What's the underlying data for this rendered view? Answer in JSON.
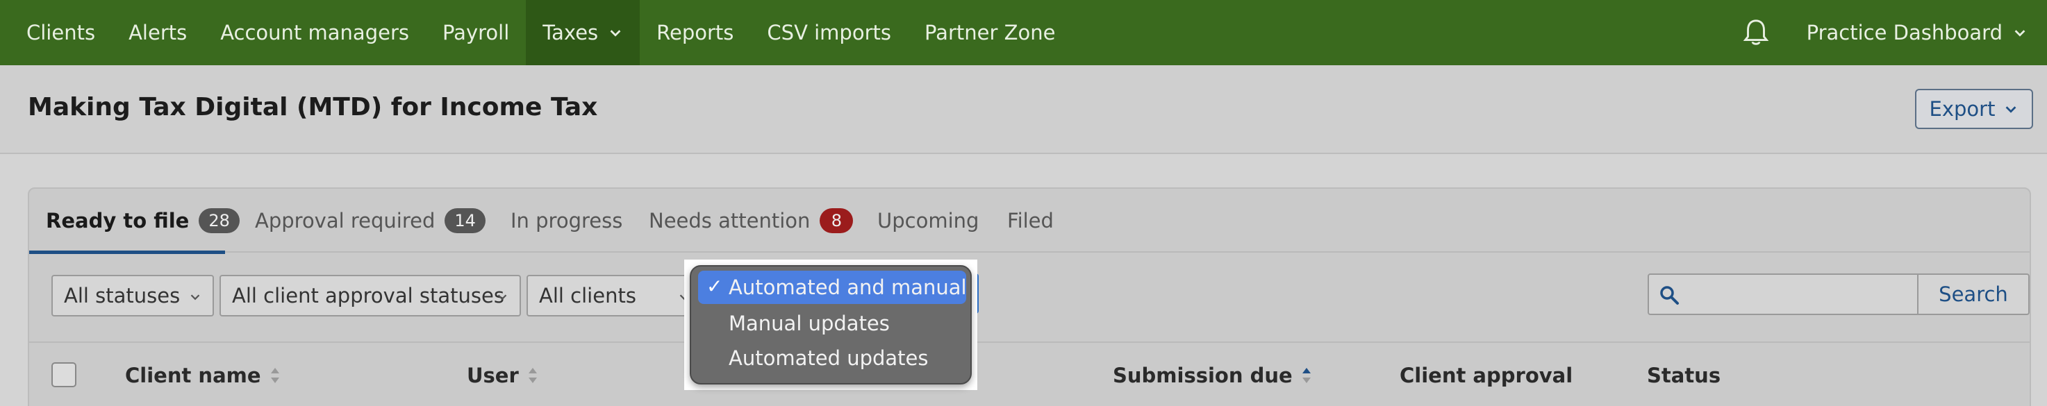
{
  "nav": {
    "items": [
      {
        "label": "Clients"
      },
      {
        "label": "Alerts"
      },
      {
        "label": "Account managers"
      },
      {
        "label": "Payroll"
      },
      {
        "label": "Taxes"
      },
      {
        "label": "Reports"
      },
      {
        "label": "CSV imports"
      },
      {
        "label": "Partner Zone"
      }
    ],
    "active": "Taxes",
    "dashboard_label": "Practice Dashboard",
    "icons": {
      "notifications": "bell-icon",
      "dropdown": "chevron-down-icon"
    }
  },
  "page": {
    "title": "Making Tax Digital (MTD) for Income Tax",
    "export_label": "Export"
  },
  "tabs": [
    {
      "label": "Ready to file",
      "count": "28",
      "active": true
    },
    {
      "label": "Approval required",
      "count": "14"
    },
    {
      "label": "In progress"
    },
    {
      "label": "Needs attention",
      "count": "8"
    },
    {
      "label": "Upcoming"
    },
    {
      "label": "Filed"
    }
  ],
  "filters": {
    "status": "All statuses",
    "approval": "All client approval statuses",
    "clients": "All clients",
    "search_label": "Search",
    "search_placeholder": ""
  },
  "dropdown": {
    "options": [
      {
        "label": "Automated and manual",
        "selected": true
      },
      {
        "label": "Manual updates"
      },
      {
        "label": "Automated updates"
      }
    ],
    "check": "✓"
  },
  "table": {
    "columns": [
      "Client name",
      "User",
      "Submission due",
      "Client approval",
      "Status"
    ]
  },
  "colors": {
    "nav_bg": "#3a6a1e",
    "accent": "#1e4f85",
    "alert_badge": "#9b1c1c",
    "selection": "#4c7fe0"
  }
}
